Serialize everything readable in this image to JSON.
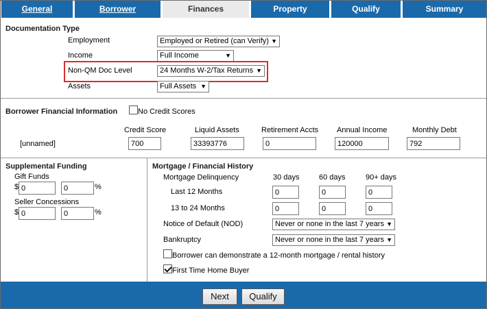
{
  "tabs": [
    {
      "label": "General",
      "active": false
    },
    {
      "label": "Borrower",
      "active": false
    },
    {
      "label": "Finances",
      "active": true
    },
    {
      "label": "Property",
      "active": false
    },
    {
      "label": "Qualify",
      "active": false
    },
    {
      "label": "Summary",
      "active": false
    }
  ],
  "documentation": {
    "title": "Documentation Type",
    "employment_label": "Employment",
    "employment_value": "Employed or Retired (can Verify)",
    "income_label": "Income",
    "income_value": "Full Income",
    "nonqm_label": "Non-QM Doc Level",
    "nonqm_value": "24 Months W-2/Tax Returns",
    "assets_label": "Assets",
    "assets_value": "Full Assets"
  },
  "financial": {
    "title": "Borrower Financial Information",
    "no_credit_label": "No Credit Scores",
    "no_credit_checked": false,
    "headers": {
      "credit_score": "Credit Score",
      "liquid_assets": "Liquid Assets",
      "retirement": "Retirement Accts",
      "annual_income": "Annual Income",
      "monthly_debt": "Monthly Debt"
    },
    "row": {
      "name": "[unnamed]",
      "credit_score": "700",
      "liquid_assets": "33393776",
      "retirement": "0",
      "annual_income": "120000",
      "monthly_debt": "792"
    }
  },
  "supplemental": {
    "title": "Supplemental Funding",
    "gift_label": "Gift Funds",
    "gift_amount": "0",
    "gift_percent": "0",
    "seller_label": "Seller Concessions",
    "seller_amount": "0",
    "seller_percent": "0",
    "dollar": "$",
    "percent": "%"
  },
  "history": {
    "title": "Mortgage / Financial History",
    "delinquency_label": "Mortgage Delinquency",
    "col_30": "30 days",
    "col_60": "60 days",
    "col_90": "90+ days",
    "last12_label": "Last 12 Months",
    "last12": [
      "0",
      "0",
      "0"
    ],
    "m13_24_label": "13 to 24 Months",
    "m13_24": [
      "0",
      "0",
      "0"
    ],
    "nod_label": "Notice of Default (NOD)",
    "nod_value": "Never or none in the last 7 years",
    "bankruptcy_label": "Bankruptcy",
    "bankruptcy_value": "Never or none in the last 7 years",
    "demonstrate_label": "Borrower can demonstrate a 12-month mortgage / rental history",
    "demonstrate_checked": false,
    "first_time_label": "First Time Home Buyer",
    "first_time_checked": true
  },
  "footer": {
    "next_label": "Next",
    "qualify_label": "Qualify"
  },
  "colors": {
    "tab_blue": "#1a6aab",
    "highlight_red": "#d62d2d"
  }
}
